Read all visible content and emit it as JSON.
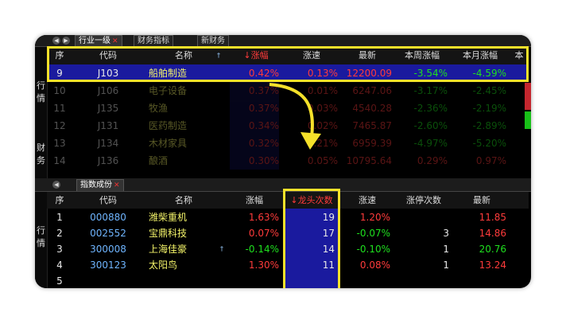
{
  "top": {
    "tabs": [
      {
        "label": "行业一级",
        "close": "✕",
        "active": true
      },
      {
        "label": "财务指标",
        "active": false
      },
      {
        "label": "新财务",
        "active": false
      }
    ],
    "side_labels": [
      "行",
      "情",
      "财",
      "务"
    ],
    "columns": [
      "序",
      "代码",
      "名称",
      "↓涨幅",
      "涨速",
      "最新",
      "本周涨幅",
      "本月涨幅",
      "本"
    ],
    "rows": [
      {
        "seq": "9",
        "code": "J103",
        "name": "船舶制造",
        "chg": "0.42%",
        "speed": "0.13%",
        "last": "12200.09",
        "week": "-3.54%",
        "month": "-4.59%"
      },
      {
        "seq": "10",
        "code": "J106",
        "name": "电子设备",
        "chg": "0.37%",
        "speed": "0.01%",
        "last": "6247.06",
        "week": "-3.17%",
        "month": "-2.45%"
      },
      {
        "seq": "11",
        "code": "J135",
        "name": "牧渔",
        "chg": "0.37%",
        "speed": "0.03%",
        "last": "4540.28",
        "week": "-2.36%",
        "month": "-2.19%"
      },
      {
        "seq": "12",
        "code": "J131",
        "name": "医药制造",
        "chg": "0.34%",
        "speed": "0.02%",
        "last": "7465.87",
        "week": "-2.60%",
        "month": "-2.89%"
      },
      {
        "seq": "13",
        "code": "J134",
        "name": "木材家具",
        "chg": "0.32%",
        "speed": "0.21%",
        "last": "6959.39",
        "week": "-4.97%",
        "month": "-5.20%"
      },
      {
        "seq": "14",
        "code": "J136",
        "name": "酿酒",
        "chg": "0.30%",
        "speed": "0.05%",
        "last": "10795.64",
        "week": "0.29%",
        "month": "0.97%"
      }
    ]
  },
  "bottom": {
    "tabs": [
      {
        "label": "指数成份",
        "close": "✕",
        "active": true
      }
    ],
    "side_labels": [
      "行",
      "情"
    ],
    "columns": [
      "序",
      "代码",
      "名称",
      "涨幅",
      "↓龙头次数",
      "涨速",
      "涨停次数",
      "最新"
    ],
    "rows": [
      {
        "seq": "1",
        "code": "000880",
        "name": "潍柴重机",
        "pin": "",
        "chg": "1.63%",
        "times": "19",
        "speed": "1.20%",
        "limit": "",
        "last": "11.85"
      },
      {
        "seq": "2",
        "code": "002552",
        "name": "宝鼎科技",
        "pin": "",
        "chg": "0.07%",
        "times": "17",
        "speed": "-0.07%",
        "limit": "3",
        "last": "14.86"
      },
      {
        "seq": "3",
        "code": "300008",
        "name": "上海佳豪",
        "pin": "†",
        "chg": "-0.14%",
        "times": "14",
        "speed": "-0.10%",
        "limit": "1",
        "last": "20.76"
      },
      {
        "seq": "4",
        "code": "300123",
        "name": "太阳鸟",
        "pin": "",
        "chg": "1.30%",
        "times": "11",
        "speed": "0.08%",
        "limit": "1",
        "last": "13.24"
      },
      {
        "seq": "5",
        "code": "",
        "name": "",
        "pin": "",
        "chg": "",
        "times": "",
        "speed": "",
        "limit": "",
        "last": ""
      }
    ]
  },
  "colors": {
    "highlight": "#f5e12a",
    "selection": "#1a1a9e",
    "up": "#ff3b3b",
    "down": "#1ee01e"
  }
}
